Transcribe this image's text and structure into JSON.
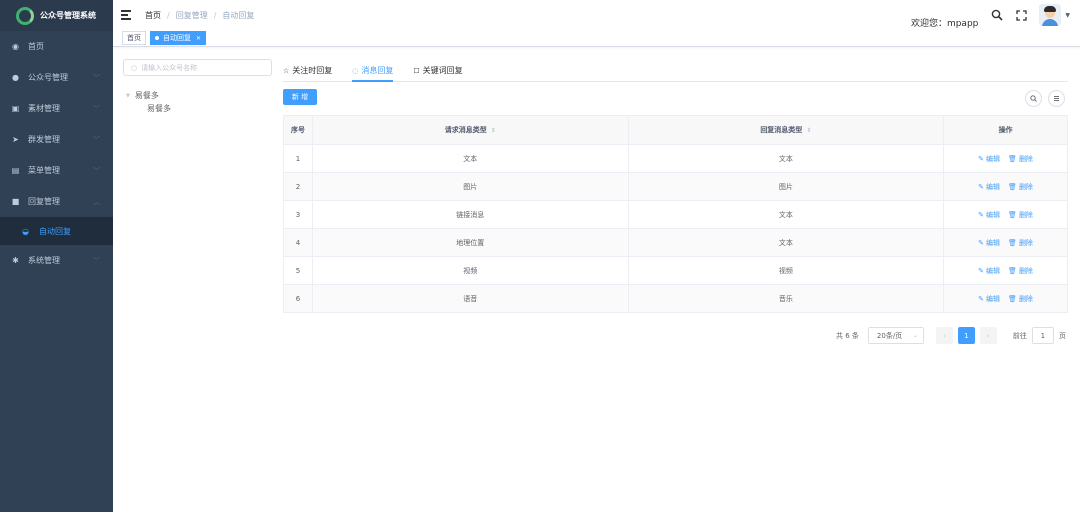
{
  "app": {
    "title": "公众号管理系统"
  },
  "sidebar": {
    "items": [
      {
        "label": "首页",
        "icon": "dashboard-icon",
        "glyph": "◉",
        "has_arrow": false
      },
      {
        "label": "公众号管理",
        "icon": "wechat-icon",
        "glyph": "●",
        "has_arrow": true
      },
      {
        "label": "素材管理",
        "icon": "document-icon",
        "glyph": "▣",
        "has_arrow": true
      },
      {
        "label": "群发管理",
        "icon": "send-icon",
        "glyph": "➤",
        "has_arrow": true
      },
      {
        "label": "菜单管理",
        "icon": "menu-doc-icon",
        "glyph": "▤",
        "has_arrow": true
      },
      {
        "label": "回复管理",
        "icon": "reply-icon",
        "glyph": "■",
        "has_arrow": true,
        "expanded": true
      },
      {
        "label": "系统管理",
        "icon": "settings-icon",
        "glyph": "✱",
        "has_arrow": true
      }
    ],
    "active_sub": {
      "label": "自动回复",
      "icon": "gauge-icon",
      "glyph": "◒"
    }
  },
  "header": {
    "breadcrumb": [
      "首页",
      "回复管理",
      "自动回复"
    ],
    "welcome": "欢迎您：mpapp"
  },
  "tags": [
    {
      "label": "首页",
      "active": false
    },
    {
      "label": "自动回复",
      "active": true
    }
  ],
  "tree_search": {
    "placeholder": "请输入公众号名称"
  },
  "tree": {
    "root": "易餐多",
    "child": "易餐多"
  },
  "tabs": [
    {
      "label": "关注时回复",
      "icon": "star-icon",
      "glyph": "☆",
      "active": false
    },
    {
      "label": "消息回复",
      "icon": "chat-icon",
      "glyph": "◌",
      "active": true
    },
    {
      "label": "关键词回复",
      "icon": "edit-box-icon",
      "glyph": "☐",
      "active": false
    }
  ],
  "toolbar": {
    "new_label": "新 增"
  },
  "table": {
    "headers": [
      "序号",
      "请求消息类型",
      "回复消息类型",
      "操作"
    ],
    "rows": [
      {
        "no": "1",
        "request": "文本",
        "reply": "文本"
      },
      {
        "no": "2",
        "request": "图片",
        "reply": "图片"
      },
      {
        "no": "3",
        "request": "链接消息",
        "reply": "文本"
      },
      {
        "no": "4",
        "request": "地理位置",
        "reply": "文本"
      },
      {
        "no": "5",
        "request": "视频",
        "reply": "视频"
      },
      {
        "no": "6",
        "request": "语音",
        "reply": "音乐"
      }
    ],
    "edit_label": "编辑",
    "delete_label": "删除"
  },
  "pagination": {
    "total": "共 6 条",
    "page_size": "20条/页",
    "current_page": "1",
    "goto_label": "前往",
    "goto_value": "1",
    "page_unit": "页"
  },
  "colors": {
    "sidebar_bg": "#304156",
    "accent": "#409eff"
  }
}
